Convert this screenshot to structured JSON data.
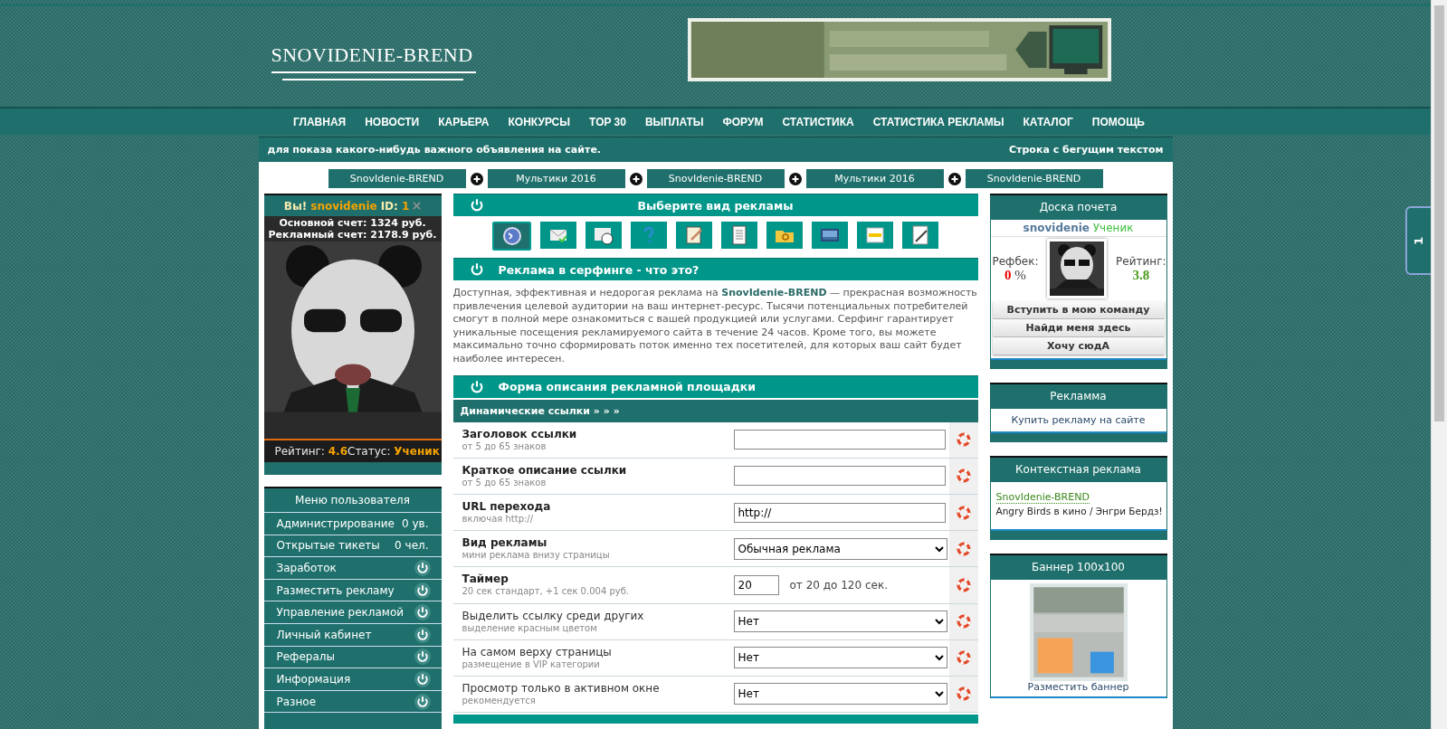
{
  "header": {
    "logo": "SNOVIDENIE-BREND"
  },
  "nav": [
    "ГЛАВНАЯ",
    "НОВОСТИ",
    "КАРЬЕРА",
    "КОНКУРСЫ",
    "TOP 30",
    "ВЫПЛАТЫ",
    "ФОРУМ",
    "СТАТИСТИКА",
    "СТАТИСТИКА РЕКЛАМЫ",
    "КАТАЛОГ",
    "ПОМОЩЬ"
  ],
  "ticker": {
    "left": "для показа какого-нибудь важного объявления на сайте.",
    "right": "Строка с бегущим текстом"
  },
  "top_tabs": [
    "SnovIdenie-BREND",
    "Мультики 2016",
    "SnovIdenie-BREND",
    "Мультики 2016",
    "SnovIdenie-BREND"
  ],
  "user": {
    "greeting": "Вы!",
    "name": "snovidenie",
    "id_label": "ID:",
    "id": "1",
    "main_balance": "Основной счет: 1324 руб.",
    "ad_balance": "Рекламный счет: 2178.9 руб.",
    "rating_label": "Рейтинг:",
    "rating": "4.6",
    "status_label": "Статус:",
    "status": "Ученик"
  },
  "user_menu": {
    "title": "Меню пользователя",
    "items": [
      {
        "label": "Администрирование",
        "kind": "count",
        "value": "0 ув."
      },
      {
        "label": "Открытые тикеты",
        "kind": "count",
        "value": "0 чел."
      },
      {
        "label": "Заработок",
        "kind": "toggle"
      },
      {
        "label": "Разместить рекламу",
        "kind": "toggle"
      },
      {
        "label": "Управление рекламой",
        "kind": "toggle"
      },
      {
        "label": "Личный кабинет",
        "kind": "toggle"
      },
      {
        "label": "Рефералы",
        "kind": "toggle"
      },
      {
        "label": "Информация",
        "kind": "toggle"
      },
      {
        "label": "Разное",
        "kind": "toggle"
      }
    ]
  },
  "ad_type": {
    "title": "Выберите вид рекламы",
    "types": [
      {
        "selected": true
      },
      {
        "selected": false
      },
      {
        "selected": false
      },
      {
        "selected": false
      },
      {
        "selected": false
      },
      {
        "selected": false
      },
      {
        "selected": false
      },
      {
        "selected": false
      },
      {
        "selected": false
      },
      {
        "selected": false
      }
    ]
  },
  "about": {
    "title": "Реклама в серфинге - что это?",
    "text": "Доступная, эффективная и недорогая реклама на **SnovIdenie-BREND** — прекрасная возможность привлечения целевой аудитории на ваш интернет-ресурс. Тысячи потенциальных потребителей смогут в полной мере ознакомиться с вашей продукцией или услугами. Серфинг гарантирует уникальные посещения рекламируемого сайта в течение 24 часов. Кроме того, вы можете максимально точно сформировать поток именно тех посетителей, для которых ваш сайт будет наиболее интересен."
  },
  "form": {
    "title": "Форма описания рекламной площадки",
    "subtitle": "Динамические ссылки » » »",
    "rows": [
      {
        "label": "Заголовок ссылки",
        "hint": "от 5 до 65 знаков",
        "bold": true,
        "kind": "text"
      },
      {
        "label": "Краткое описание ссылки",
        "hint": "от 5 до 65 знаков",
        "bold": true,
        "kind": "text"
      },
      {
        "label": "URL перехода",
        "hint": "включая http://",
        "bold": true,
        "kind": "text",
        "value": "http://"
      },
      {
        "label": "Вид рекламы",
        "hint": "мини реклама внизу страницы",
        "bold": true,
        "kind": "select",
        "value": "Обычная реклама"
      },
      {
        "label": "Таймер",
        "hint": "20 сек стандарт, +1 сек 0.004 руб.",
        "bold": true,
        "kind": "timer",
        "value": "20",
        "note": "от 20 до 120 сек."
      },
      {
        "label": "Выделить ссылку среди других",
        "hint": "выделение красным цветом",
        "bold": false,
        "kind": "select",
        "value": "Нет"
      },
      {
        "label": "На самом верху страницы",
        "hint": "размещение в VIP категории",
        "bold": false,
        "kind": "select",
        "value": "Нет"
      },
      {
        "label": "Просмотр только в активном окне",
        "hint": "рекомендуется",
        "bold": false,
        "kind": "select",
        "value": "Нет"
      }
    ]
  },
  "honor_board": {
    "title": "Доска почета",
    "name": "snovidenie",
    "rank": "Ученик",
    "refback_label": "Рефбек:",
    "refback": "0",
    "refback_unit": "%",
    "rating_label": "Рейтинг:",
    "rating": "3.8",
    "buttons": [
      "Вступить в мою команду",
      "Найди меня здесь",
      "Хочу сюдА"
    ]
  },
  "ads_box": {
    "title": "Рекламма",
    "link": "Купить рекламу на сайте"
  },
  "context_ads": {
    "title": "Контекстная реклама",
    "link": "SnovIdenie-BREND",
    "text": "Angry Birds в кино / Энгри Бердз!"
  },
  "banner_box": {
    "title": "Баннер 100x100",
    "link": "Разместить баннер"
  },
  "side_tab": "1"
}
